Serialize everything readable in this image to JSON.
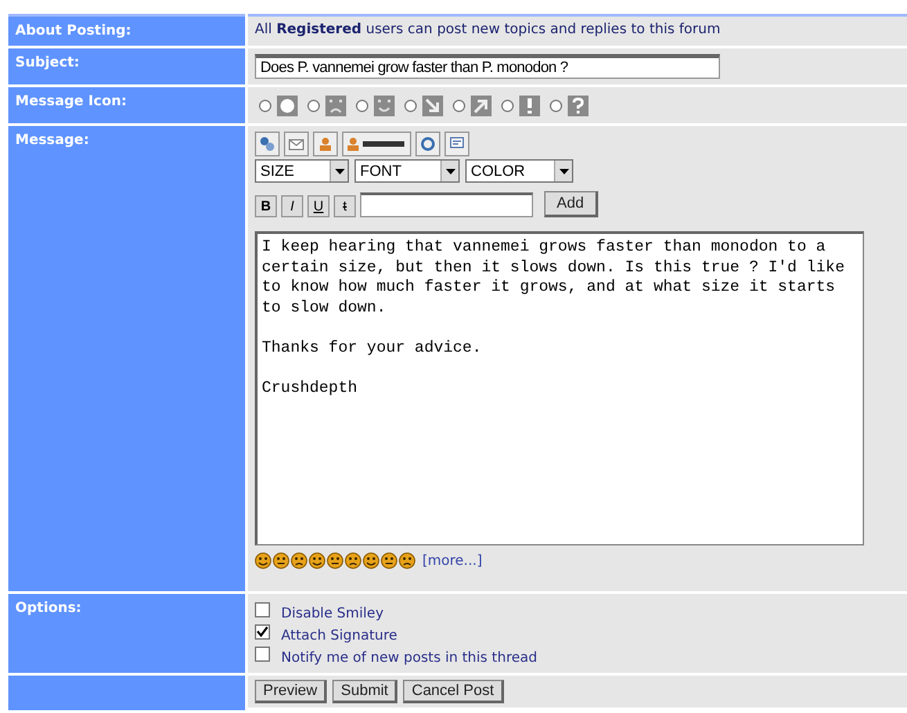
{
  "rows": {
    "about": {
      "label": "About Posting:",
      "text": "All **Registered** users can post new topics and replies to this forum"
    },
    "subject": {
      "label": "Subject:",
      "value": "Does P. vannemei grow faster than P. monodon ?"
    },
    "icon": {
      "label": "Message Icon:",
      "choices": [
        {
          "selected": false
        },
        {
          "selected": false
        },
        {
          "selected": false
        },
        {
          "selected": false
        },
        {
          "selected": false
        },
        {
          "selected": false
        },
        {
          "selected": false
        }
      ]
    },
    "message": {
      "label": "Message:",
      "selects": [
        "SIZE",
        "FONT",
        "COLOR"
      ],
      "format_buttons": [
        "B",
        "I",
        "U",
        "t"
      ],
      "add_button": "Add",
      "body": "I keep hearing that vannemei grows faster than monodon to a certain size, but then it slows down. Is this true ? I'd like to know how much faster it grows, and at what size it starts to slow down.\n\nThanks for your advice.\n\nCrushdepth",
      "more_link": "[more...]"
    },
    "options": {
      "label": "Options:",
      "items": [
        {
          "label": "Disable Smiley",
          "checked": false
        },
        {
          "label": "Attach Signature",
          "checked": true
        },
        {
          "label": "Notify me of new posts in this thread",
          "checked": false
        }
      ]
    },
    "buttons": [
      "Preview",
      "Submit",
      "Cancel Post"
    ]
  }
}
